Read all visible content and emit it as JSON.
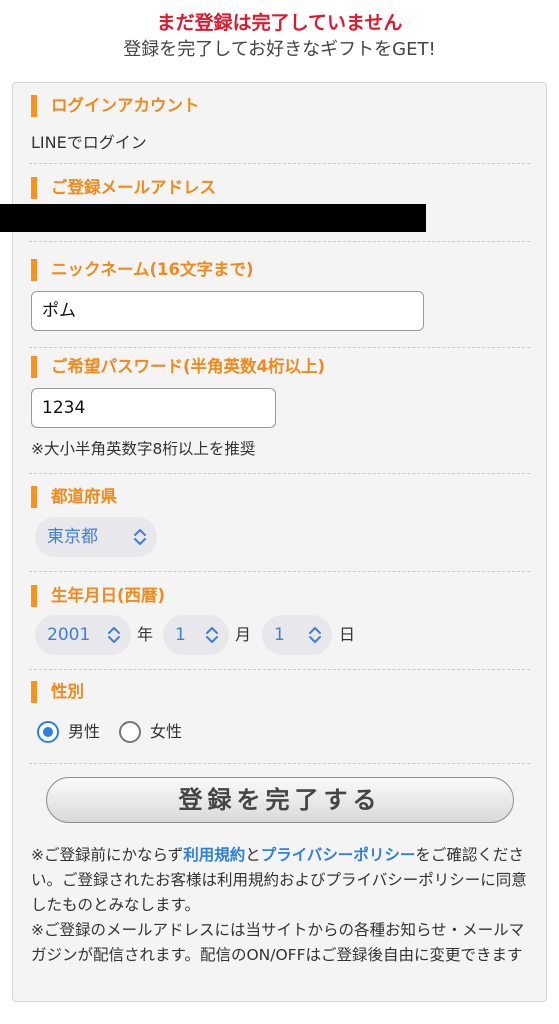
{
  "header": {
    "warning": "まだ登録は完了していません",
    "subtitle": "登録を完了してお好きなギフトをGET!"
  },
  "login": {
    "label": "ログインアカウント",
    "value": "LINEでログイン"
  },
  "email": {
    "label": "ご登録メールアドレス"
  },
  "nickname": {
    "label": "ニックネーム(16文字まで)",
    "value": "ポム"
  },
  "password": {
    "label": "ご希望パスワード(半角英数4桁以上)",
    "value": "1234",
    "note": "※大小半角英数字8桁以上を推奨"
  },
  "prefecture": {
    "label": "都道府県",
    "selected": "東京都"
  },
  "birthday": {
    "label": "生年月日(西暦)",
    "year": "2001",
    "year_unit": "年",
    "month": "1",
    "month_unit": "月",
    "day": "1",
    "day_unit": "日"
  },
  "gender": {
    "label": "性別",
    "male": "男性",
    "female": "女性",
    "selected": "male"
  },
  "submit_label": "登録を完了する",
  "footer": {
    "p1_pre": "※ご登録前にかならず",
    "terms_link": "利用規約",
    "and": "と",
    "privacy_link": "プライバシーポリシー",
    "p1_post": "をご確認ください。ご登録されたお客様は利用規約およびプライバシーポリシーに同意したものとみなします。",
    "p2": "※ご登録のメールアドレスには当サイトからの各種お知らせ・メールマガジンが配信されます。配信のON/OFFはご登録後自由に変更できます"
  },
  "colors": {
    "accent": "#f7921e",
    "warning": "#e0182d",
    "link": "#2f7fe0"
  }
}
